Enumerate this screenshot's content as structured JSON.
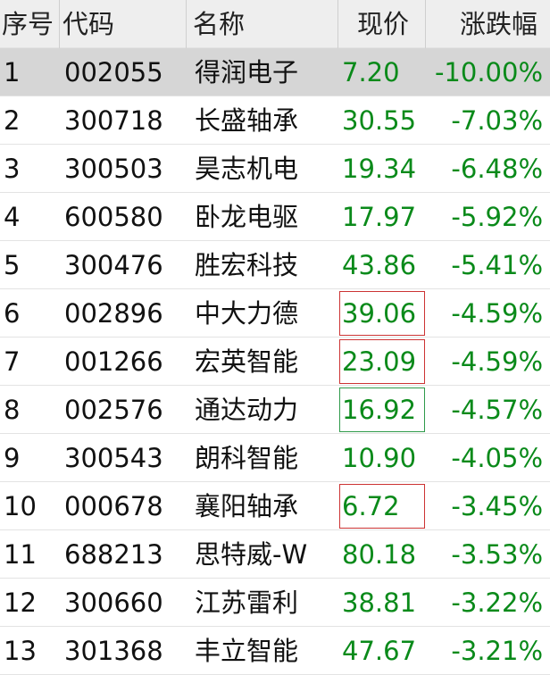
{
  "colors": {
    "down": "#0a8a1a",
    "box_red": "#cc3333",
    "box_green": "#2e9a4a",
    "selected_bg": "#d6d6d6",
    "header_bg": "#eeeeee"
  },
  "header": {
    "rank": "序号",
    "code": "代码",
    "name": "名称",
    "price": "现价",
    "change": "涨跌幅"
  },
  "rows": [
    {
      "rank": "1",
      "code": "002055",
      "name": "得润电子",
      "price": "7.20",
      "change": "-10.00%",
      "selected": true,
      "box": ""
    },
    {
      "rank": "2",
      "code": "300718",
      "name": "长盛轴承",
      "price": "30.55",
      "change": "-7.03%",
      "selected": false,
      "box": ""
    },
    {
      "rank": "3",
      "code": "300503",
      "name": "昊志机电",
      "price": "19.34",
      "change": "-6.48%",
      "selected": false,
      "box": ""
    },
    {
      "rank": "4",
      "code": "600580",
      "name": "卧龙电驱",
      "price": "17.97",
      "change": "-5.92%",
      "selected": false,
      "box": ""
    },
    {
      "rank": "5",
      "code": "300476",
      "name": "胜宏科技",
      "price": "43.86",
      "change": "-5.41%",
      "selected": false,
      "box": ""
    },
    {
      "rank": "6",
      "code": "002896",
      "name": "中大力德",
      "price": "39.06",
      "change": "-4.59%",
      "selected": false,
      "box": "red"
    },
    {
      "rank": "7",
      "code": "001266",
      "name": "宏英智能",
      "price": "23.09",
      "change": "-4.59%",
      "selected": false,
      "box": "red"
    },
    {
      "rank": "8",
      "code": "002576",
      "name": "通达动力",
      "price": "16.92",
      "change": "-4.57%",
      "selected": false,
      "box": "green"
    },
    {
      "rank": "9",
      "code": "300543",
      "name": "朗科智能",
      "price": "10.90",
      "change": "-4.05%",
      "selected": false,
      "box": ""
    },
    {
      "rank": "10",
      "code": "000678",
      "name": "襄阳轴承",
      "price": "6.72",
      "change": "-3.45%",
      "selected": false,
      "box": "red"
    },
    {
      "rank": "11",
      "code": "688213",
      "name": "思特威-W",
      "price": "80.18",
      "change": "-3.53%",
      "selected": false,
      "box": ""
    },
    {
      "rank": "12",
      "code": "300660",
      "name": "江苏雷利",
      "price": "38.81",
      "change": "-3.22%",
      "selected": false,
      "box": ""
    },
    {
      "rank": "13",
      "code": "301368",
      "name": "丰立智能",
      "price": "47.67",
      "change": "-3.21%",
      "selected": false,
      "box": ""
    }
  ]
}
